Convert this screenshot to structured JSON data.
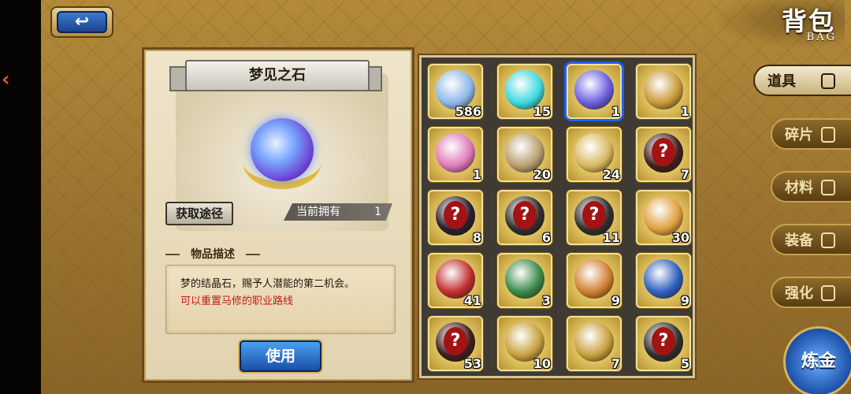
{
  "header": {
    "back_symbol": "↩",
    "title": "背包",
    "subtitle": "BAG"
  },
  "detail": {
    "item_name": "梦见之石",
    "source_button": "获取途径",
    "owned_label": "当前拥有",
    "owned_value": "1",
    "desc_heading": "物品描述",
    "desc_line1": "梦的结晶石，赐予人潜能的第二机会。",
    "desc_line2": "可以重置马修的职业路线",
    "use_button": "使用"
  },
  "inventory": {
    "selected_index": 2,
    "items": [
      {
        "name": "hourglass",
        "count": "586",
        "color": "#8fb8e8"
      },
      {
        "name": "cyan-crystal",
        "count": "15",
        "color": "#3fd8e0"
      },
      {
        "name": "dream-stone",
        "count": "1",
        "color": "#6b5fe0"
      },
      {
        "name": "ornate-chest",
        "count": "1",
        "color": "#c89a3a"
      },
      {
        "name": "pink-pouch",
        "count": "1",
        "color": "#e07ab8"
      },
      {
        "name": "silver-chest",
        "count": "20",
        "color": "#b8a070"
      },
      {
        "name": "gold-chest",
        "count": "24",
        "color": "#d8b860"
      },
      {
        "name": "mystery-scroll",
        "count": "7",
        "color": "#402020"
      },
      {
        "name": "mystery-frame",
        "count": "8",
        "color": "#2a2030"
      },
      {
        "name": "mystery-diamond",
        "count": "6",
        "color": "#303030"
      },
      {
        "name": "mystery-diamond",
        "count": "11",
        "color": "#303030"
      },
      {
        "name": "fruit-basket",
        "count": "30",
        "color": "#e0a040"
      },
      {
        "name": "red-wings",
        "count": "41",
        "color": "#c03030"
      },
      {
        "name": "green-armor",
        "count": "3",
        "color": "#3a8a4a"
      },
      {
        "name": "orange-helmet",
        "count": "9",
        "color": "#d08030"
      },
      {
        "name": "blue-gear",
        "count": "9",
        "color": "#3060c0"
      },
      {
        "name": "mystery-scroll",
        "count": "53",
        "color": "#402020"
      },
      {
        "name": "gold-chest",
        "count": "10",
        "color": "#c8a040"
      },
      {
        "name": "gold-chest",
        "count": "7",
        "color": "#c8a040"
      },
      {
        "name": "mystery-diamond",
        "count": "5",
        "color": "#303030"
      }
    ]
  },
  "tabs": [
    {
      "label": "道具",
      "icon": "flask-icon",
      "active": true
    },
    {
      "label": "碎片",
      "icon": "shard-icon",
      "active": false
    },
    {
      "label": "材料",
      "icon": "leaf-icon",
      "active": false
    },
    {
      "label": "装备",
      "icon": "helmet-icon",
      "active": false
    },
    {
      "label": "强化",
      "icon": "wing-icon",
      "active": false
    }
  ],
  "alchemy_button": "炼金"
}
